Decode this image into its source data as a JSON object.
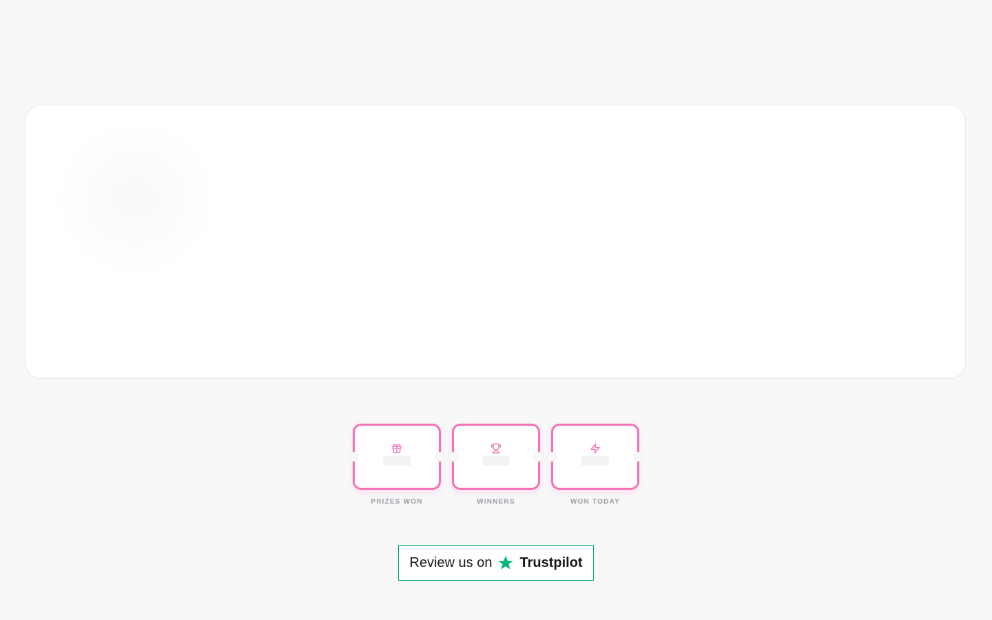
{
  "colors": {
    "accent": "#f472b6",
    "trustpilot_green": "#00b67a",
    "page_bg": "#f8f8f9",
    "label_gray": "#9a9aa2"
  },
  "stats": [
    {
      "icon": "gift-icon",
      "label": "PRIZES WON"
    },
    {
      "icon": "trophy-icon",
      "label": "WINNERS"
    },
    {
      "icon": "lightning-icon",
      "label": "WON TODAY"
    }
  ],
  "trustpilot": {
    "prefix": "Review us on",
    "icon": "trustpilot-star-icon",
    "brand": "Trustpilot"
  }
}
